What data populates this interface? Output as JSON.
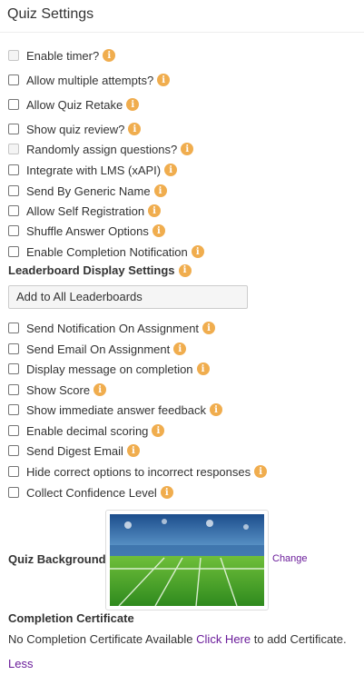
{
  "title": "Quiz Settings",
  "options_a": [
    {
      "label": "Enable timer?",
      "disabled": true
    },
    {
      "label": "Allow multiple attempts?",
      "disabled": false
    },
    {
      "label": "Allow Quiz Retake",
      "disabled": false
    },
    {
      "label": "Show quiz review?",
      "disabled": false
    },
    {
      "label": "Randomly assign questions?",
      "disabled": true
    },
    {
      "label": "Integrate with LMS (xAPI)",
      "disabled": false
    },
    {
      "label": "Send By Generic Name",
      "disabled": false
    },
    {
      "label": "Allow Self Registration",
      "disabled": false
    },
    {
      "label": "Shuffle Answer Options",
      "disabled": false
    },
    {
      "label": "Enable Completion Notification",
      "disabled": false
    }
  ],
  "leaderboard": {
    "heading": "Leaderboard Display Settings",
    "select_value": "Add to All Leaderboards"
  },
  "options_b": [
    {
      "label": "Send Notification On Assignment"
    },
    {
      "label": "Send Email On Assignment"
    },
    {
      "label": "Display message on completion"
    },
    {
      "label": "Show Score"
    },
    {
      "label": "Show immediate answer feedback"
    },
    {
      "label": "Enable decimal scoring"
    },
    {
      "label": "Send Digest Email"
    },
    {
      "label": "Hide correct options to incorrect responses"
    },
    {
      "label": "Collect Confidence Level"
    }
  ],
  "info_glyph": "i",
  "background": {
    "label": "Quiz Background",
    "change_label": "Change"
  },
  "certificate": {
    "heading": "Completion Certificate",
    "text_before": "No Completion Certificate Available ",
    "link_text": "Click Here",
    "text_after": " to add Certificate."
  },
  "less_label": "Less",
  "colors": {
    "info_badge": "#f0ad4e",
    "link": "#6a1b9a"
  }
}
